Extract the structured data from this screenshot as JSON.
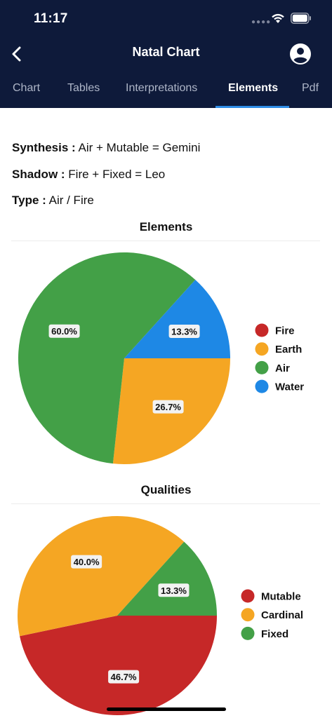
{
  "status_bar": {
    "time": "11:17"
  },
  "nav": {
    "title": "Natal Chart"
  },
  "tabs": [
    {
      "label": "Chart",
      "active": false
    },
    {
      "label": "Tables",
      "active": false
    },
    {
      "label": "Interpretations",
      "active": false
    },
    {
      "label": "Elements",
      "active": true
    },
    {
      "label": "Pdf",
      "active": false
    }
  ],
  "summary": {
    "synthesis_label": "Synthesis :",
    "synthesis_value": "Air + Mutable = Gemini",
    "shadow_label": "Shadow :",
    "shadow_value": "Fire + Fixed = Leo",
    "type_label": "Type :",
    "type_value": "Air / Fire"
  },
  "icons": {
    "back": "chevron-left-icon",
    "account": "account-circle-icon",
    "wifi": "wifi-icon",
    "battery": "battery-icon"
  },
  "colors": {
    "header_bg": "#0e1a3a",
    "tab_indicator": "#2e8ce6",
    "fire": "#c62828",
    "earth": "#f5a623",
    "air": "#43a047",
    "water": "#1e88e5"
  },
  "chart_data": [
    {
      "type": "pie",
      "title": "Elements",
      "legend_position": "right",
      "slices": [
        {
          "label": "Fire",
          "value": 0.0,
          "percent_label": "",
          "color": "#c62828"
        },
        {
          "label": "Earth",
          "value": 26.7,
          "percent_label": "26.7%",
          "color": "#f5a623"
        },
        {
          "label": "Air",
          "value": 60.0,
          "percent_label": "60.0%",
          "color": "#43a047"
        },
        {
          "label": "Water",
          "value": 13.3,
          "percent_label": "13.3%",
          "color": "#1e88e5"
        }
      ]
    },
    {
      "type": "pie",
      "title": "Qualities",
      "legend_position": "right",
      "slices": [
        {
          "label": "Mutable",
          "value": 46.7,
          "percent_label": "46.7%",
          "color": "#c62828"
        },
        {
          "label": "Cardinal",
          "value": 40.0,
          "percent_label": "40.0%",
          "color": "#f5a623"
        },
        {
          "label": "Fixed",
          "value": 13.3,
          "percent_label": "13.3%",
          "color": "#43a047"
        }
      ]
    }
  ]
}
